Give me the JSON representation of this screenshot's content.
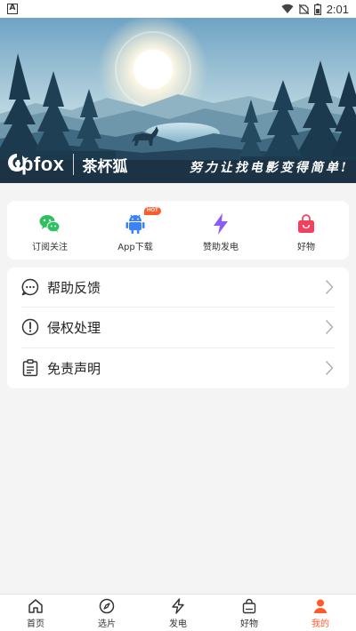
{
  "status_bar": {
    "notification": "A",
    "time": "2:01"
  },
  "banner": {
    "brand_name": "upfox",
    "brand_cn": "茶杯狐",
    "slogan": "努力让找电影变得简单!"
  },
  "quick_actions": [
    {
      "label": "订阅关注",
      "icon": "wechat-icon",
      "color": "#2fc15f"
    },
    {
      "label": "App下载",
      "icon": "android-icon",
      "color": "#3b82f6",
      "badge": "HOT"
    },
    {
      "label": "赞助发电",
      "icon": "lightning-icon",
      "color": "#8b5cf6"
    },
    {
      "label": "好物",
      "icon": "shopping-bag-icon",
      "color": "#f43f5e"
    }
  ],
  "menu": [
    {
      "label": "帮助反馈",
      "icon": "chat-bubble-icon"
    },
    {
      "label": "侵权处理",
      "icon": "alert-circle-icon"
    },
    {
      "label": "免责声明",
      "icon": "clipboard-icon"
    }
  ],
  "bottom_nav": [
    {
      "label": "首页",
      "icon": "home-icon"
    },
    {
      "label": "选片",
      "icon": "compass-icon"
    },
    {
      "label": "发电",
      "icon": "lightning-icon"
    },
    {
      "label": "好物",
      "icon": "bag-icon"
    },
    {
      "label": "我的",
      "icon": "user-icon",
      "active": true
    }
  ],
  "colors": {
    "accent": "#ff5a2b",
    "background": "#f4f4f4"
  }
}
